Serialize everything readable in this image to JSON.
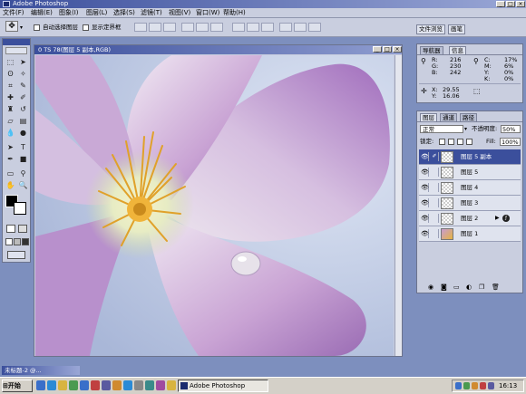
{
  "app": {
    "title": "Adobe Photoshop"
  },
  "menubar": {
    "items": [
      "文件(F)",
      "编辑(E)",
      "图象(I)",
      "图层(L)",
      "选择(S)",
      "滤镜(T)",
      "视图(V)",
      "窗口(W)",
      "帮助(H)"
    ]
  },
  "options": {
    "auto_select": "自动选择图层",
    "show_bounds": "显示定界框"
  },
  "palette_well": {
    "tabs": [
      "文件浏览",
      "画笔"
    ]
  },
  "document": {
    "title": "0 TS 78(图层 5 副本,RGB)"
  },
  "info_panel": {
    "tabs": [
      "导航器",
      "信息"
    ],
    "rgb_labels": [
      "R:",
      "G:",
      "B:"
    ],
    "rgb_values": [
      "216",
      "230",
      "242"
    ],
    "cmyk_labels": [
      "C:",
      "M:",
      "Y:",
      "K:"
    ],
    "cmyk_values": [
      "17%",
      "6%",
      "0%",
      "0%"
    ],
    "xy_labels": [
      "X:",
      "Y:"
    ],
    "xy_values": [
      "29.55",
      "16.06"
    ]
  },
  "layers_panel": {
    "tabs": [
      "图层",
      "通道",
      "路径"
    ],
    "blend_mode": "正常",
    "opacity_label": "不透明度:",
    "opacity_value": "50%",
    "lock_label": "锁定:",
    "fill_label": "Fill:",
    "fill_value": "100%",
    "layers": [
      {
        "name": "图层 5 副本",
        "selected": true
      },
      {
        "name": "图层 5",
        "selected": false
      },
      {
        "name": "图层 4",
        "selected": false
      },
      {
        "name": "图层 3",
        "selected": false
      },
      {
        "name": "图层 2",
        "selected": false
      },
      {
        "name": "图层 1",
        "selected": false
      }
    ]
  },
  "doc_button": {
    "label": "未标题-2 @..."
  },
  "taskbar": {
    "start_label": "开始",
    "ps_task": "Adobe Photoshop",
    "clock": "16:13"
  },
  "colors": {
    "accent": "#3b4f9c",
    "panel": "#c9cedf",
    "desktop": "#7d8fbe",
    "petal": "#b78ac4"
  }
}
